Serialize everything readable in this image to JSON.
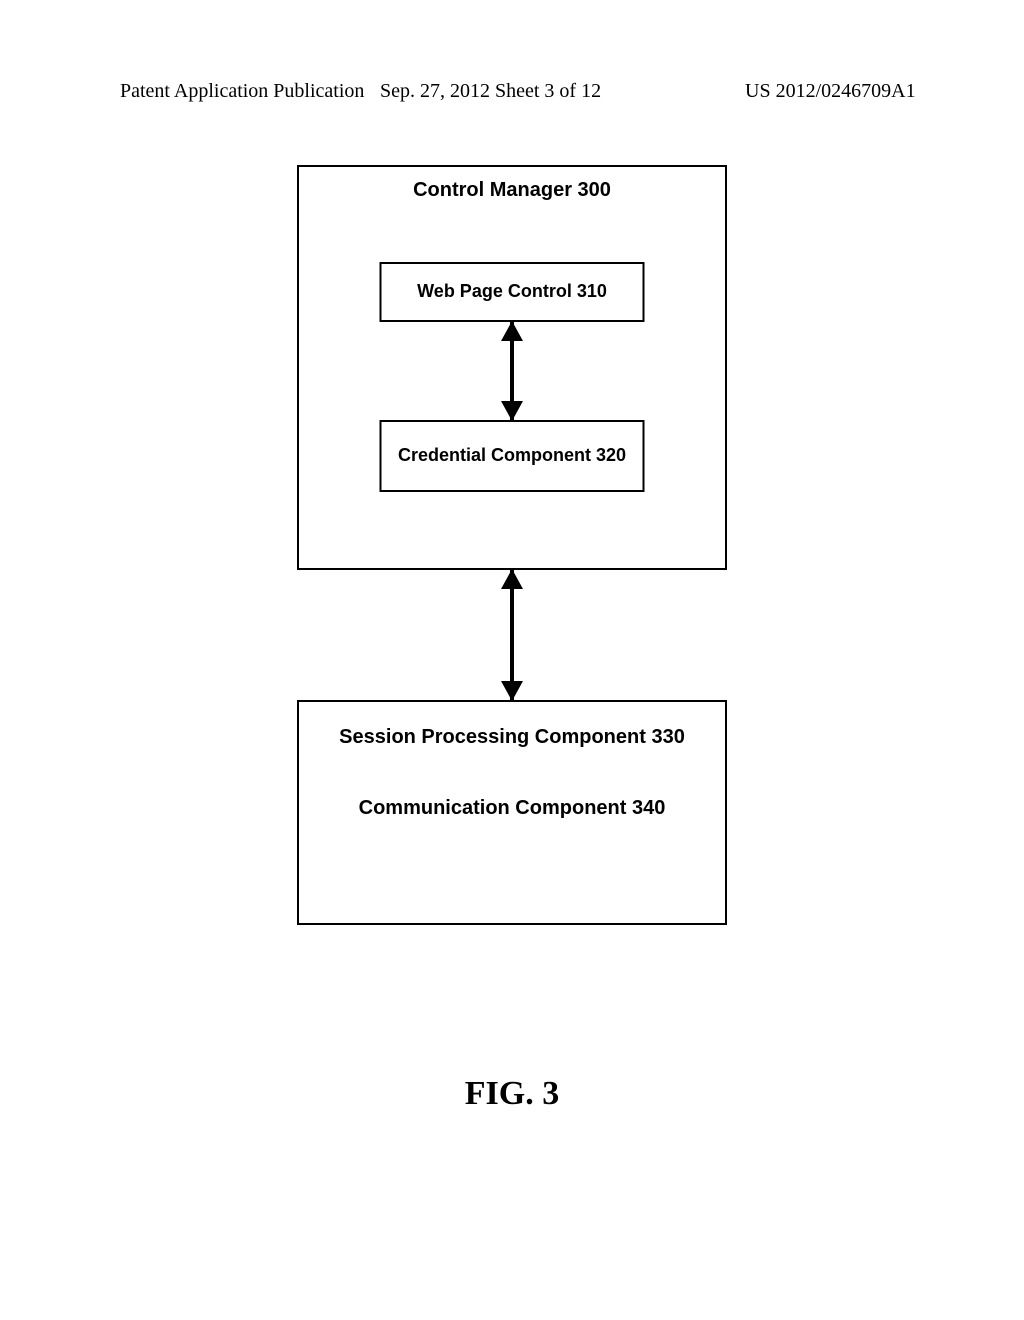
{
  "header": {
    "left": "Patent Application Publication",
    "center": "Sep. 27, 2012   Sheet 3 of 12",
    "right": "US 2012/0246709A1"
  },
  "diagram": {
    "control_manager": "Control Manager 300",
    "web_page_control": "Web Page Control 310",
    "credential_component": "Credential Component 320",
    "session_processing": "Session Processing Component 330",
    "communication_component": "Communication Component 340"
  },
  "figure_label": "FIG. 3"
}
